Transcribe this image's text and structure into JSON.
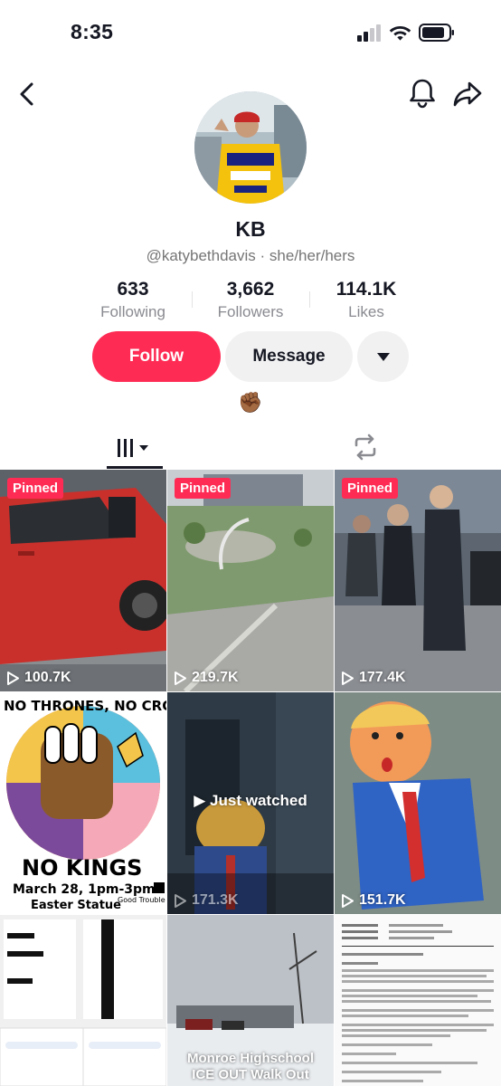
{
  "status_bar": {
    "time": "8:35"
  },
  "profile": {
    "display_name": "KB",
    "handle": "@katybethdavis",
    "pronouns": "she/her/hers",
    "separator": " · ",
    "bio": "✊🏾"
  },
  "stats": {
    "following": {
      "value": "633",
      "label": "Following"
    },
    "followers": {
      "value": "3,662",
      "label": "Followers"
    },
    "likes": {
      "value": "114.1K",
      "label": "Likes"
    }
  },
  "actions": {
    "follow": "Follow",
    "message": "Message"
  },
  "videos": [
    {
      "pinned": "Pinned",
      "views": "100.7K",
      "color": "#c9302c"
    },
    {
      "pinned": "Pinned",
      "views": "219.7K",
      "color": "#8e9a8a"
    },
    {
      "pinned": "Pinned",
      "views": "177.4K",
      "color": "#4a4f58"
    },
    {
      "views": "",
      "color": "#ffffff",
      "poster": {
        "top": "NO THRONES, NO CROWNS",
        "kings": "NO KINGS",
        "date": "March 28, 1pm-3pm",
        "place": "Easter Statue",
        "credit": "Good Trouble"
      }
    },
    {
      "views": "171.3K",
      "just_watched": "Just watched",
      "color": "#3a4a5a"
    },
    {
      "views": "151.7K",
      "color": "#5e8fb5"
    },
    {
      "views": "",
      "color": "#f0f0f0"
    },
    {
      "views": "",
      "color": "#b9bec4",
      "caption_line1": "Monroe Highschool",
      "caption_line2": "ICE OUT Walk Out"
    },
    {
      "views": "",
      "color": "#fafafa"
    }
  ]
}
